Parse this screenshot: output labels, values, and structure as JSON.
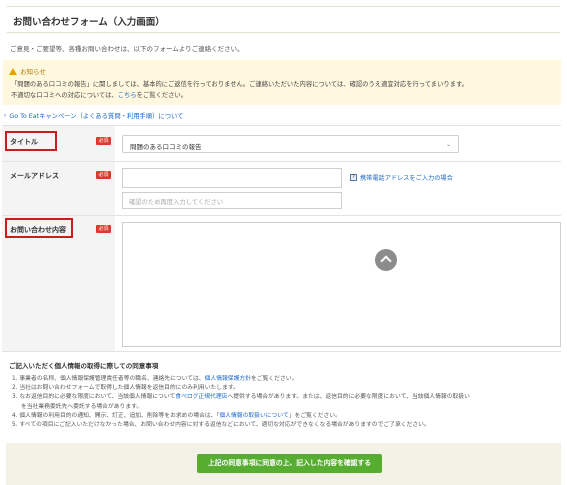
{
  "header": {
    "title": "お問い合わせフォーム（入力画面）"
  },
  "intro": "ご意見・ご要望等、各種お問い合わせは、以下のフォームよりご連絡ください。",
  "notice": {
    "heading": "お知らせ",
    "line1": "「問題のある口コミの報告」に関しましては、基本的にご返信を行っておりません。ご連絡いただいた内容については、確認のうえ適宜対応を行ってまいります。",
    "line2_prefix": "不適切な口コミへの対応については、",
    "line2_link": "こちら",
    "line2_suffix": "をご覧ください。"
  },
  "campaign_link": "Go To Eatキャンペーン（よくある質問・利用手順）について",
  "form": {
    "required_label": "必須",
    "title_row": {
      "label": "タイトル",
      "select_value": "問題のある口コミの報告"
    },
    "email_row": {
      "label": "メールアドレス",
      "email_value": "",
      "confirm_placeholder": "確認のため再度入力してください",
      "mobile_link": "携帯電話アドレスをご入力の場合"
    },
    "content_row": {
      "label": "お問い合わせ内容",
      "value": ""
    }
  },
  "privacy": {
    "title": "ご記入いただく個人情報の取得に際しての同意事項",
    "items": [
      {
        "text": "1. 事業者の名称、個人情報保護管理責任者等の職名、連絡先については、",
        "link": "個人情報保護方針",
        "suffix": "をご覧ください。"
      },
      {
        "text": "2. 当社はお問い合わせフォームで取得した個人情報を返信目的にのみ利用いたします。",
        "link": "",
        "suffix": ""
      },
      {
        "text": "3. なお返信目的に必要な限度において、当該個人情報について",
        "link": "食べログ正規代理店",
        "suffix": "へ提供する場合があります。または、返信目的に必要な限度において、当該個人情報の取扱い"
      },
      {
        "text": "を当社業務委託先へ委託する場合があります。",
        "link": "",
        "suffix": ""
      },
      {
        "text": "4. 個人情報の利用目的の通知、開示、訂正、追加、削除等をお求めの場合は、「",
        "link": "個人情報の取扱いについて",
        "suffix": "」をご覧ください。"
      },
      {
        "text": "5. すべての項目にご記入いただけなかった場合、お問い合わせ内容に対する返信などにおいて、適切な対応ができなくなる場合がありますのでご了承ください。",
        "link": "",
        "suffix": ""
      }
    ]
  },
  "submit_label": "上記の同意事項に同意の上、記入した内容を確認する",
  "colors": {
    "required": "#d93a2b",
    "highlight": "#c81e1e",
    "submit": "#57ad2f",
    "link": "#1a66c9"
  }
}
